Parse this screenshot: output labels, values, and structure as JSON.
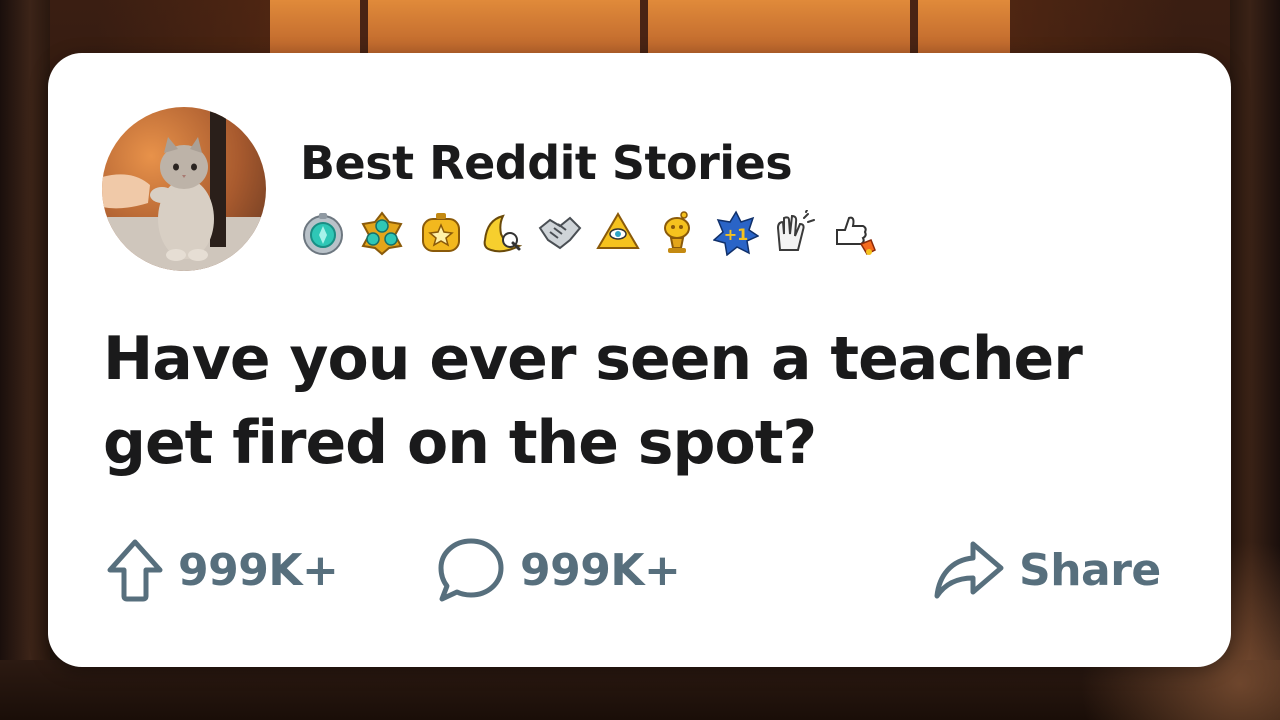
{
  "background": {
    "scene": "warm-room-window",
    "accent_color": "#b8612a"
  },
  "post": {
    "channel_name": "Best Reddit Stories",
    "avatar_icon": "cat-avatar",
    "awards": [
      "silver-gem-award-icon",
      "gold-gem-cluster-award-icon",
      "gold-star-award-icon",
      "banana-award-icon",
      "handshake-award-icon",
      "all-seeing-pyramid-award-icon",
      "gold-snoo-trophy-award-icon",
      "plus-one-award-icon",
      "clapping-hands-award-icon",
      "thumbs-up-rocket-award-icon"
    ],
    "title": "Have you ever seen a teacher get fired on the spot?",
    "upvotes": "999K+",
    "comments": "999K+",
    "share_label": "Share"
  },
  "colors": {
    "card_background": "#ffffff",
    "title_text": "#1a1a1b",
    "action_text": "#576f7d"
  }
}
